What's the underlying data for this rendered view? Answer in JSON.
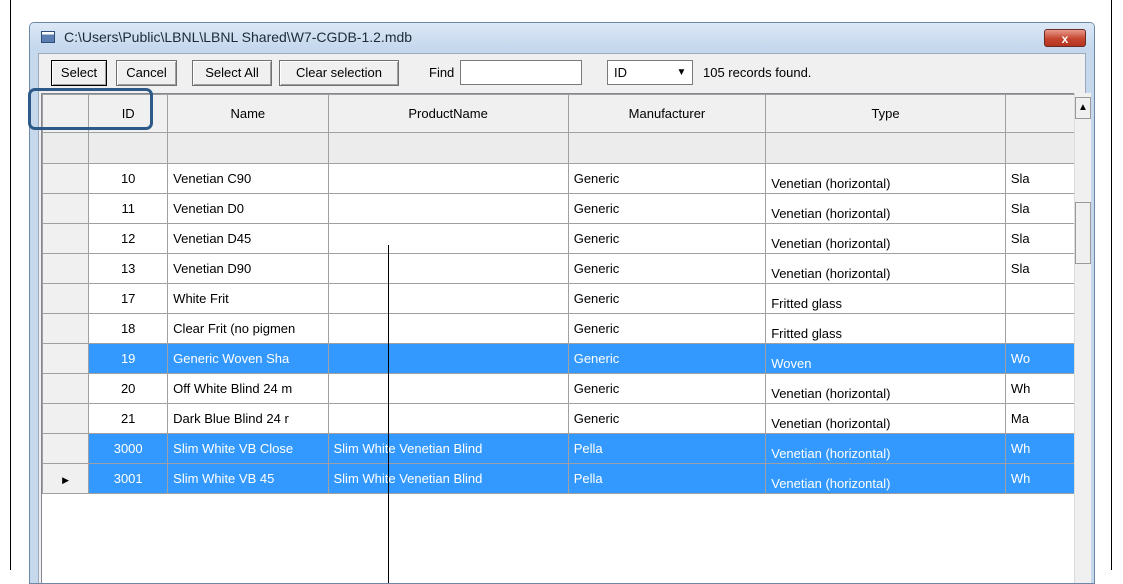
{
  "window": {
    "title": "C:\\Users\\Public\\LBNL\\LBNL Shared\\W7-CGDB-1.2.mdb",
    "close_glyph": "x"
  },
  "toolbar": {
    "select_label": "Select",
    "cancel_label": "Cancel",
    "select_all_label": "Select All",
    "clear_selection_label": "Clear selection",
    "find_label": "Find",
    "find_value": "",
    "search_field_value": "ID",
    "records_found": "105 records found."
  },
  "grid": {
    "columns": [
      "ID",
      "Name",
      "ProductName",
      "Manufacturer",
      "Type",
      ""
    ],
    "rows": [
      {
        "id": "10",
        "name": "Venetian C90",
        "product": "",
        "manufacturer": "Generic",
        "type": "Venetian (horizontal)",
        "extra": "Sla",
        "selected": false
      },
      {
        "id": "11",
        "name": "Venetian D0",
        "product": "",
        "manufacturer": "Generic",
        "type": "Venetian (horizontal)",
        "extra": "Sla",
        "selected": false
      },
      {
        "id": "12",
        "name": "Venetian D45",
        "product": "",
        "manufacturer": "Generic",
        "type": "Venetian (horizontal)",
        "extra": "Sla",
        "selected": false
      },
      {
        "id": "13",
        "name": "Venetian D90",
        "product": "",
        "manufacturer": "Generic",
        "type": "Venetian (horizontal)",
        "extra": "Sla",
        "selected": false
      },
      {
        "id": "17",
        "name": "White Frit",
        "product": "",
        "manufacturer": "Generic",
        "type": "Fritted glass",
        "extra": "",
        "selected": false
      },
      {
        "id": "18",
        "name": "Clear Frit (no pigmen",
        "product": "",
        "manufacturer": "Generic",
        "type": "Fritted glass",
        "extra": "",
        "selected": false
      },
      {
        "id": "19",
        "name": "Generic Woven Sha",
        "product": "",
        "manufacturer": "Generic",
        "type": "Woven",
        "extra": "Wo",
        "selected": true
      },
      {
        "id": "20",
        "name": "Off White Blind 24 m",
        "product": "",
        "manufacturer": "Generic",
        "type": "Venetian (horizontal)",
        "extra": "Wh",
        "selected": false
      },
      {
        "id": "21",
        "name": "Dark Blue Blind 24 r",
        "product": "",
        "manufacturer": "Generic",
        "type": "Venetian (horizontal)",
        "extra": "Ma",
        "selected": false
      },
      {
        "id": "3000",
        "name": "Slim White VB Close",
        "product": "Slim White Venetian Blind",
        "manufacturer": "Pella",
        "type": "Venetian (horizontal)",
        "extra": "Wh",
        "selected": true
      },
      {
        "id": "3001",
        "name": "Slim White VB 45",
        "product": "Slim White Venetian Blind",
        "manufacturer": "Pella",
        "type": "Venetian (horizontal)",
        "extra": "Wh",
        "selected": true,
        "current": true
      }
    ]
  },
  "icons": {
    "row_pointer": "▶",
    "dropdown_arrow": "▼",
    "scroll_up_arrow": "▲"
  },
  "colors": {
    "selection": "#3399ff",
    "highlight_border": "#2e5a8a",
    "close_button": "#c5452f"
  }
}
